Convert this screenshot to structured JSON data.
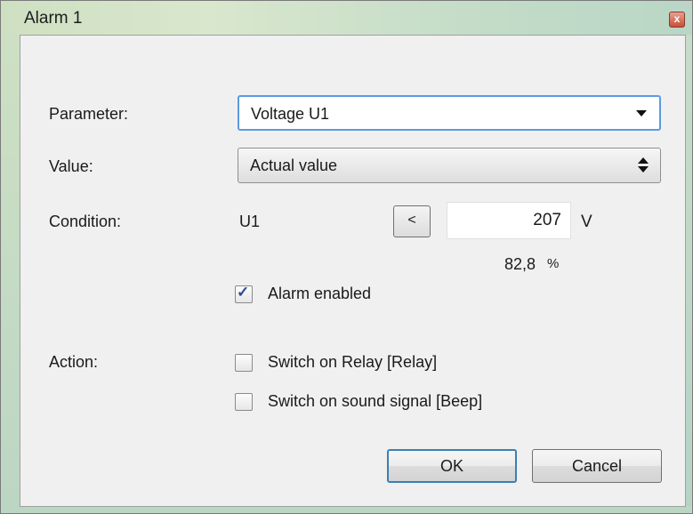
{
  "window": {
    "title": "Alarm 1",
    "close_glyph": "x"
  },
  "form": {
    "parameter_label": "Parameter:",
    "parameter_value": "Voltage U1",
    "value_label": "Value:",
    "value_value": "Actual value",
    "condition_label": "Condition:",
    "condition_variable": "U1",
    "comparator": "<",
    "threshold_value": "207",
    "threshold_unit": "V",
    "percent_value": "82,8",
    "percent_unit": "%",
    "alarm_enabled_label": "Alarm enabled",
    "alarm_enabled_checked": true,
    "action_label": "Action:",
    "relay_label": "Switch on Relay [Relay]",
    "relay_checked": false,
    "beep_label": "Switch on sound signal [Beep]",
    "beep_checked": false
  },
  "buttons": {
    "ok_label": "OK",
    "cancel_label": "Cancel"
  },
  "icons": {
    "combo_dropdown": "chevron-down-icon",
    "combo_spinner": "updown-arrows-icon",
    "close": "close-icon",
    "check": "checkmark-icon"
  },
  "colors": {
    "focus_border": "#5b9be0",
    "default_button_border": "#3c7fb1",
    "check_mark": "#2c4c8c"
  }
}
